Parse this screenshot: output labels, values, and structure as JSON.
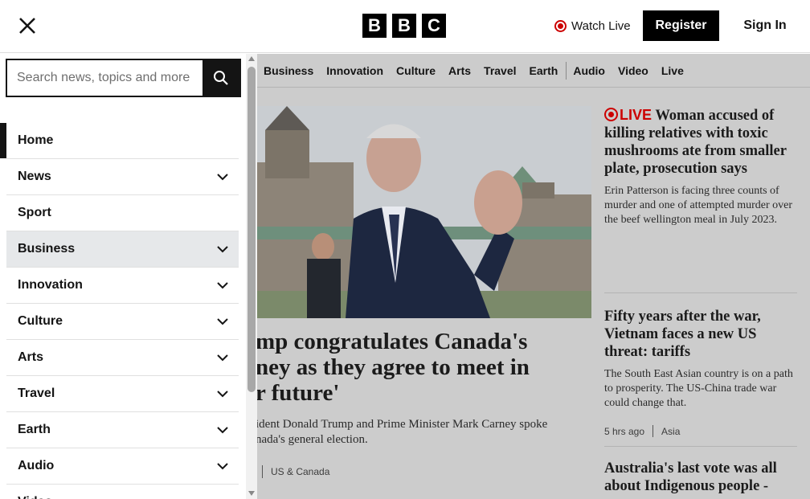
{
  "header": {
    "logo_letters": [
      "B",
      "B",
      "C"
    ],
    "watch_live": "Watch Live",
    "register": "Register",
    "sign_in": "Sign In"
  },
  "search": {
    "placeholder": "Search news, topics and more"
  },
  "drawer_menu": [
    {
      "label": "Home",
      "has_chevron": false
    },
    {
      "label": "News",
      "has_chevron": true
    },
    {
      "label": "Sport",
      "has_chevron": false
    },
    {
      "label": "Business",
      "has_chevron": true
    },
    {
      "label": "Innovation",
      "has_chevron": true
    },
    {
      "label": "Culture",
      "has_chevron": true
    },
    {
      "label": "Arts",
      "has_chevron": true
    },
    {
      "label": "Travel",
      "has_chevron": true
    },
    {
      "label": "Earth",
      "has_chevron": true
    },
    {
      "label": "Audio",
      "has_chevron": true
    },
    {
      "label": "Video",
      "has_chevron": false
    }
  ],
  "top_nav": [
    "Business",
    "Innovation",
    "Culture",
    "Arts",
    "Travel",
    "Earth",
    "Audio",
    "Video",
    "Live"
  ],
  "hero": {
    "headline_lines": [
      "mp congratulates Canada's",
      "ney as they agree to meet in",
      "r future'"
    ],
    "summary_lines": [
      "ident Donald Trump and Prime Minister Mark Carney spoke",
      "nada's general election."
    ],
    "section": "US & Canada"
  },
  "stories": [
    {
      "live_label": "LIVE",
      "title": "Woman accused of killing relatives with toxic mushrooms ate from smaller plate, prosecution says",
      "summary": "Erin Patterson is facing three counts of murder and one of attempted murder over the beef wellington meal in July 2023."
    },
    {
      "title": "Fifty years after the war, Vietnam faces a new US threat: tariffs",
      "summary": "The South East Asian country is on a path to prosperity. The US-China trade war could change that.",
      "time": "5 hrs ago",
      "section": "Asia"
    },
    {
      "title": "Australia's last vote was all about Indigenous people -"
    }
  ],
  "colors": {
    "live_red": "#cc0000",
    "brand_black": "#000000",
    "overlay_grey": "#cccccc"
  }
}
